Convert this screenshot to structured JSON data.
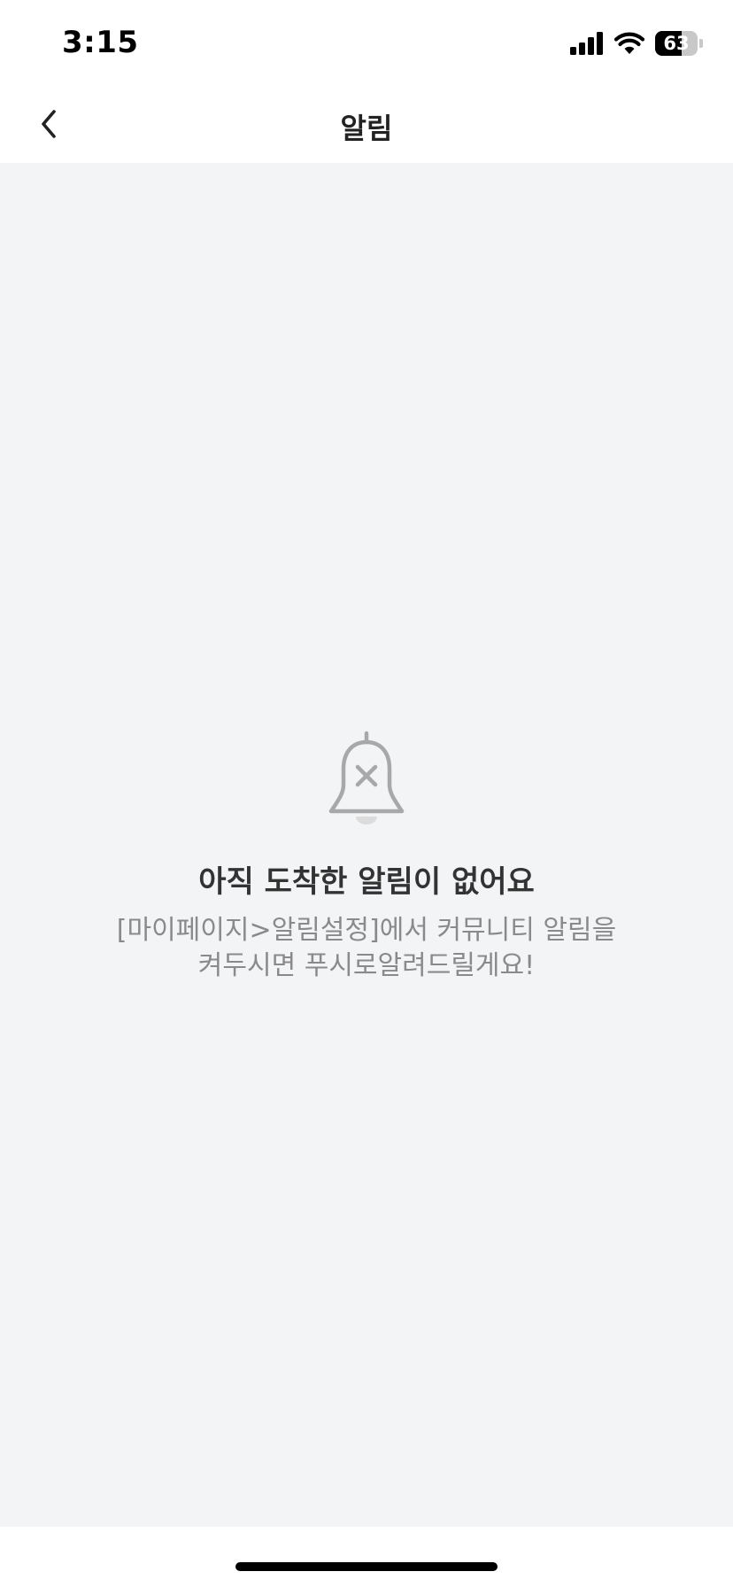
{
  "status_bar": {
    "time": "3:15",
    "battery_level": "63",
    "battery_fraction": 0.63,
    "icons": [
      "signal-icon",
      "wifi-icon",
      "battery-icon"
    ]
  },
  "nav": {
    "title": "알림",
    "back_icon": "chevron-left-icon"
  },
  "empty_state": {
    "icon": "bell-off-icon",
    "title": "아직 도착한 알림이 없어요",
    "description_line1": "[마이페이지>알림설정]에서 커뮤니티 알림을",
    "description_line2": "켜두시면 푸시로알려드릴게요!"
  },
  "colors": {
    "background": "#f3f4f6",
    "title_text": "#333333",
    "description_text": "#8a8a8a",
    "icon": "#a8a8a8"
  }
}
